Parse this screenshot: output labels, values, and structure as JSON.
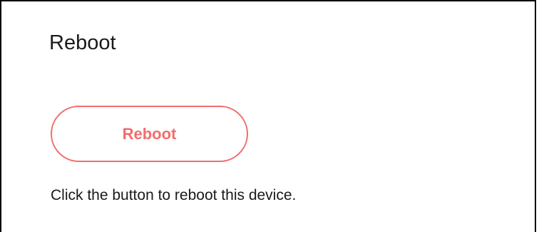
{
  "reboot_section": {
    "title": "Reboot",
    "button_label": "Reboot",
    "description": "Click the button to reboot this device."
  },
  "colors": {
    "accent": "#f26d6d",
    "text": "#1a1a1a",
    "border": "#000000",
    "background": "#ffffff"
  }
}
